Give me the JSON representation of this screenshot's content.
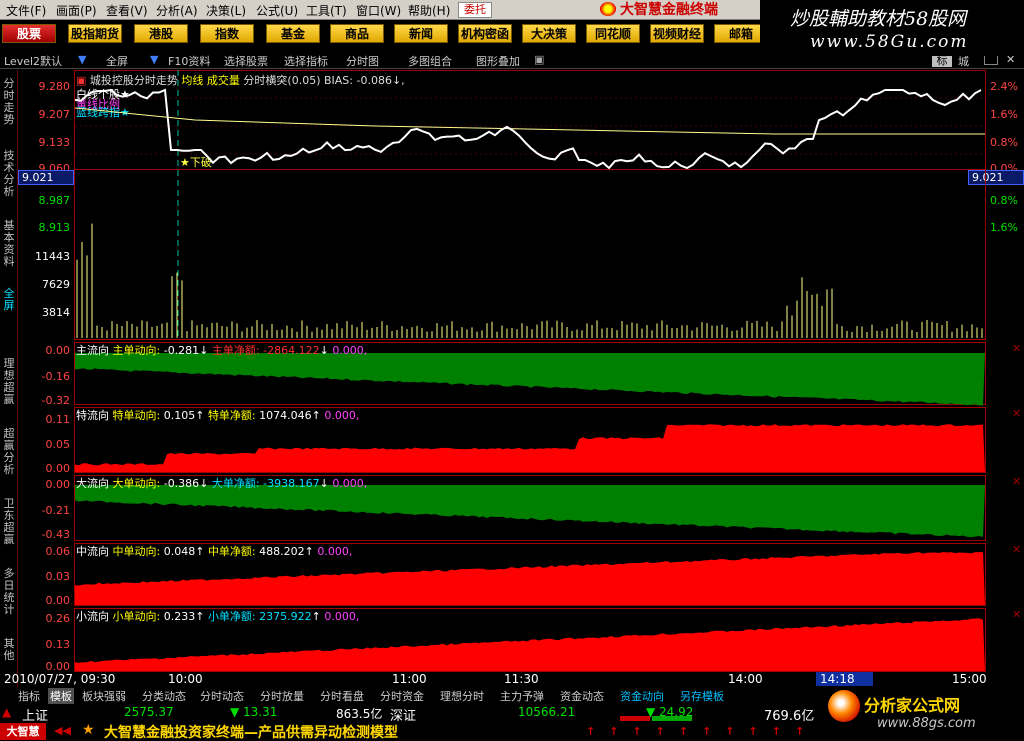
{
  "menu": [
    "文件(F)",
    "画面(P)",
    "查看(V)",
    "分析(A)",
    "决策(L)",
    "公式(U)",
    "工具(T)",
    "窗口(W)",
    "帮助(H)"
  ],
  "weituo": "委托",
  "brand": "大智慧金融终端",
  "watermark": {
    "line1": "炒股輔助教材58股网",
    "line2": "www.58Gu.com"
  },
  "toolbar": [
    "股票",
    "股指期货",
    "港股",
    "指数",
    "基金",
    "商品",
    "新闻",
    "机构密函",
    "大决策",
    "同花顺",
    "视频财经",
    "邮箱"
  ],
  "subbar": {
    "level2": "Level2默认",
    "fullscreen": "全屏",
    "f10": "F10资料",
    "select_stock": "选择股票",
    "select_index": "选择指标",
    "timechart": "分时图",
    "multi": "多图组合",
    "overlay": "图形叠加",
    "biao": "标",
    "cheng": "城"
  },
  "left_tabs": [
    "分时走势",
    "技术分析",
    "基本资料",
    "全屏",
    "理想超赢",
    "超赢分析",
    "卫东超赢",
    "多日统计",
    "其他"
  ],
  "price_panel": {
    "title_stock": "城投控股分时走势",
    "title_avg": "均线",
    "title_vol": "成交量",
    "title_rest": "分时横突(0.05) BIAS: -0.086↓,",
    "legend1": "白线个股★",
    "legend2": "黄线比例",
    "legend3": "蓝线跨指★",
    "breakdown": "下破",
    "y_left": [
      "9.280",
      "9.207",
      "9.133",
      "9.060"
    ],
    "y_left_box": "9.021",
    "y_left_low": [
      "8.987",
      "8.913"
    ],
    "y_right": [
      "2.4%",
      "1.6%",
      "0.8%",
      "0.0%"
    ],
    "y_right_box": "9.021",
    "y_right_low": [
      "0.8%",
      "1.6%"
    ]
  },
  "volume_panel": {
    "y": [
      "11443",
      "7629",
      "3814"
    ]
  },
  "flow_panels": [
    {
      "name": "主流向",
      "label": "主单动向:",
      "value": "-0.281",
      "arrow": "↓",
      "net_label": "主单净额:",
      "net": "-2864.122",
      "net_arrow": "↓",
      "zero": "0.000,",
      "y": [
        "0.00",
        "-0.16",
        "-0.32"
      ]
    },
    {
      "name": "特流向",
      "label": "特单动向:",
      "value": "0.105",
      "arrow": "↑",
      "net_label": "特单净额:",
      "net": "1074.046",
      "net_arrow": "↑",
      "zero": "0.000,",
      "y": [
        "0.11",
        "0.05",
        "0.00"
      ]
    },
    {
      "name": "大流向",
      "label": "大单动向:",
      "value": "-0.386",
      "arrow": "↓",
      "net_label": "大单净额:",
      "net": "-3938.167",
      "net_arrow": "↓",
      "zero": "0.000,",
      "y": [
        "0.00",
        "-0.21",
        "-0.43"
      ]
    },
    {
      "name": "中流向",
      "label": "中单动向:",
      "value": "0.048",
      "arrow": "↑",
      "net_label": "中单净额:",
      "net": "488.202",
      "net_arrow": "↑",
      "zero": "0.000,",
      "y": [
        "0.06",
        "0.03",
        "0.00"
      ]
    },
    {
      "name": "小流向",
      "label": "小单动向:",
      "value": "0.233",
      "arrow": "↑",
      "net_label": "小单净额:",
      "net": "2375.922",
      "net_arrow": "↑",
      "zero": "0.000,",
      "y": [
        "0.26",
        "0.13",
        "0.00"
      ]
    }
  ],
  "time_axis": {
    "start": "2010/07/27, 09:30",
    "t1": "10:00",
    "t2": "11:00",
    "t3": "11:30",
    "t4": "14:00",
    "cursor": "14:18",
    "t5": "15:00"
  },
  "bottom_tabs": [
    "指标",
    "模板",
    "板块强弱",
    "分类动态",
    "分时动态",
    "分时放量",
    "分时看盘",
    "分时资金",
    "理想分时",
    "主力予弹",
    "资金动态",
    "资金动向",
    "另存模板"
  ],
  "status": {
    "sh_label": "上证",
    "sh_index": "2575.37",
    "sh_change": "▼ 13.31",
    "sh_amount": "863.5亿",
    "sz_label": "深证",
    "sz_index": "10566.21",
    "sz_change": "▼ 24.92",
    "sz_amount": "769.6亿"
  },
  "ticker": {
    "badge": "大智慧",
    "text": "大智慧金融投资家终端—产品供需异动检测模型"
  },
  "ad": {
    "name": "分析家公式网",
    "url": "www.88gs.com"
  },
  "colors": {
    "up": "#ff0000",
    "down": "#008000",
    "axis": "#a00000",
    "price": "#ffffff",
    "avg": "#ffff80"
  }
}
